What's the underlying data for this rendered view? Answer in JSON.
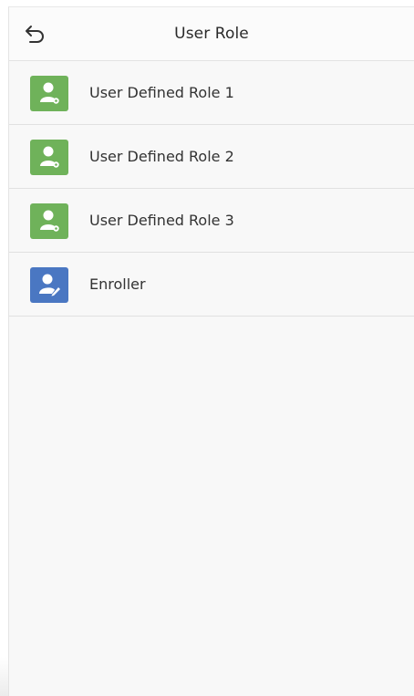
{
  "header": {
    "title": "User Role",
    "back_icon": "back-arrow-icon"
  },
  "colors": {
    "defined_role_icon": "#6fb25a",
    "enroller_icon": "#4a77c2"
  },
  "roles": [
    {
      "label": "User Defined Role 1",
      "icon": "user-role-icon",
      "color": "green"
    },
    {
      "label": "User Defined Role 2",
      "icon": "user-role-icon",
      "color": "green"
    },
    {
      "label": "User Defined Role 3",
      "icon": "user-role-icon",
      "color": "green"
    },
    {
      "label": "Enroller",
      "icon": "enroller-icon",
      "color": "blue"
    }
  ]
}
